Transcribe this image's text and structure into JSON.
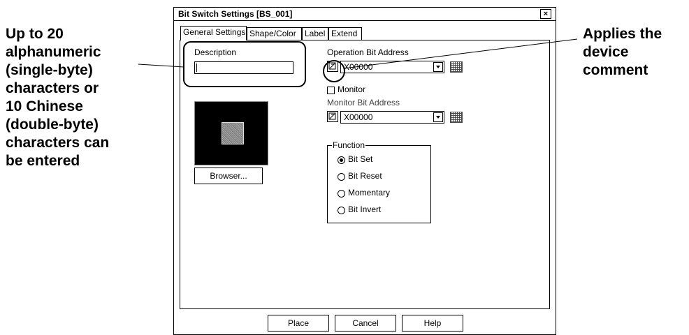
{
  "annotations": {
    "left_lines": [
      "Up to 20",
      "alphanumeric",
      "(single-byte)",
      "characters or",
      "10 Chinese",
      "(double-byte)",
      "characters can",
      "be entered"
    ],
    "right_lines": [
      "Applies the",
      "device",
      "comment"
    ]
  },
  "dialog": {
    "title": "Bit Switch Settings [BS_001]",
    "close_glyph": "×",
    "tabs": [
      "General Settings",
      "Shape/Color",
      "Label",
      "Extend"
    ],
    "active_tab": "General Settings",
    "description": {
      "label": "Description",
      "value": ""
    },
    "browser_button": "Browser...",
    "operation": {
      "label": "Operation Bit Address",
      "value": "X00000"
    },
    "monitor": {
      "checkbox_label": "Monitor",
      "checked": false,
      "address_label": "Monitor Bit Address",
      "address_value": "X00000"
    },
    "function": {
      "title": "Function",
      "options": [
        "Bit Set",
        "Bit Reset",
        "Momentary",
        "Bit Invert"
      ],
      "selected": "Bit Set"
    },
    "footer_buttons": {
      "place": "Place",
      "cancel": "Cancel",
      "help": "Help"
    }
  },
  "icons": {
    "close": "close-icon",
    "device_comment": "device-comment-icon",
    "keypad": "keypad-icon",
    "dropdown": "chevron-down-icon"
  }
}
